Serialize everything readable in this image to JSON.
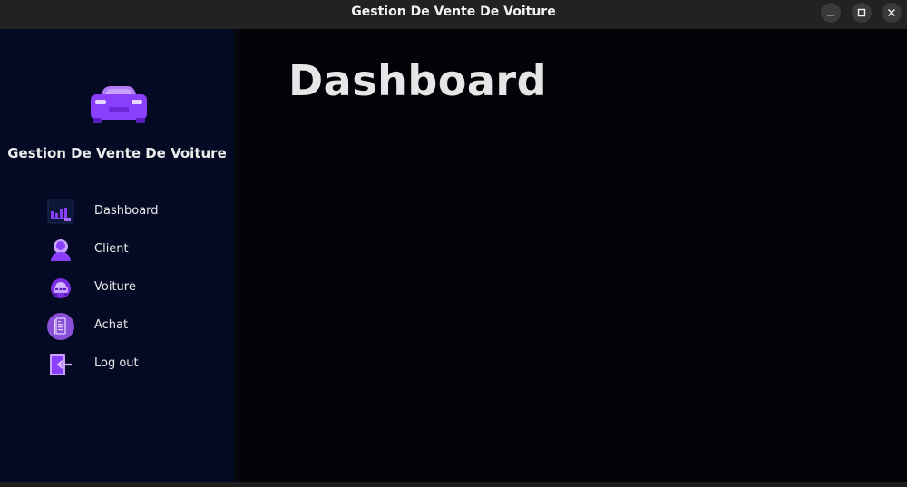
{
  "window": {
    "title": "Gestion De Vente De Voiture",
    "controls": [
      "minimize-icon",
      "maximize-icon",
      "close-icon"
    ]
  },
  "sidebar": {
    "app_name": "Gestion De Vente De Voiture",
    "logo_icon": "car-icon",
    "items": [
      {
        "label": "Dashboard",
        "icon": "chart-icon"
      },
      {
        "label": "Client",
        "icon": "user-icon"
      },
      {
        "label": "Voiture",
        "icon": "car-icon"
      },
      {
        "label": "Achat",
        "icon": "receipt-icon"
      },
      {
        "label": "Log out",
        "icon": "logout-icon"
      }
    ]
  },
  "main": {
    "title": "Dashboard"
  },
  "colors": {
    "accent": "#8a3ffc",
    "sidebar_bg": "#050a24",
    "main_bg": "#030208",
    "titlebar_bg": "#222222"
  }
}
